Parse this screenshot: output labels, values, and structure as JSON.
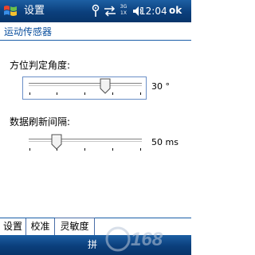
{
  "title_bar": {
    "title": "设置",
    "network_label_top": "3G",
    "network_label_bottom": "1X",
    "time": "12:04",
    "ok_label": "ok"
  },
  "header": {
    "title": "运动传感器"
  },
  "orientation": {
    "label": "方位判定角度:",
    "value_text": "30 °",
    "value": 30
  },
  "refresh": {
    "label": "数据刷新间隔:",
    "value_text": "50 ms",
    "value": 50
  },
  "tabs": [
    {
      "label": "设置"
    },
    {
      "label": "校准"
    },
    {
      "label": "灵敏度"
    }
  ],
  "bottom_bar": {
    "input_label": "拼"
  },
  "watermark": {
    "text": "168"
  }
}
